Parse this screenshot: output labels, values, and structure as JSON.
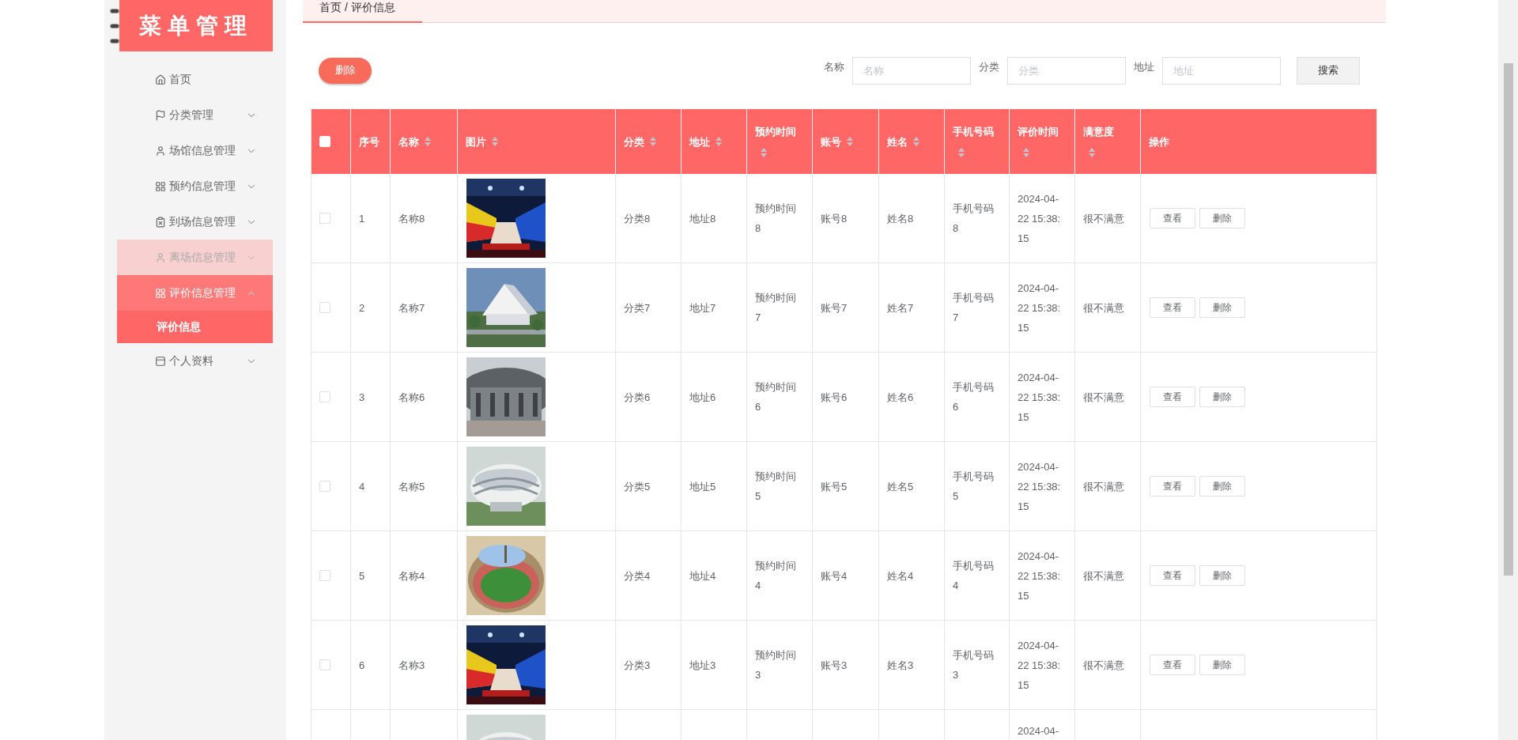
{
  "sidebar": {
    "logo": "菜单管理",
    "items": [
      {
        "label": "首页",
        "expandable": false,
        "expanded": false,
        "highlighted": false,
        "selected": false
      },
      {
        "label": "分类管理",
        "expandable": true,
        "expanded": false,
        "highlighted": false,
        "selected": false
      },
      {
        "label": "场馆信息管理",
        "expandable": true,
        "expanded": false,
        "highlighted": false,
        "selected": false
      },
      {
        "label": "预约信息管理",
        "expandable": true,
        "expanded": false,
        "highlighted": false,
        "selected": false
      },
      {
        "label": "到场信息管理",
        "expandable": true,
        "expanded": false,
        "highlighted": false,
        "selected": false
      },
      {
        "label": "离场信息管理",
        "expandable": true,
        "expanded": false,
        "highlighted": true,
        "selected": false
      },
      {
        "label": "评价信息管理",
        "expandable": true,
        "expanded": true,
        "highlighted": false,
        "selected": false,
        "children": [
          {
            "label": "评价信息",
            "selected": true
          }
        ]
      },
      {
        "label": "个人资料",
        "expandable": true,
        "expanded": false,
        "highlighted": false,
        "selected": false
      }
    ]
  },
  "breadcrumb": "首页 / 评价信息",
  "toolbar": {
    "delete_button": "删除",
    "search_fields": [
      {
        "label": "名称",
        "placeholder": "名称"
      },
      {
        "label": "分类",
        "placeholder": "分类"
      },
      {
        "label": "地址",
        "placeholder": "地址"
      }
    ],
    "search_button": "搜索"
  },
  "table": {
    "header_checkbox": {
      "checked": false
    },
    "columns": [
      {
        "label": "序号",
        "sortable": false
      },
      {
        "label": "名称",
        "sortable": true
      },
      {
        "label": "图片",
        "sortable": true
      },
      {
        "label": "分类",
        "sortable": true
      },
      {
        "label": "地址",
        "sortable": true
      },
      {
        "label": "预约时间",
        "sortable": true
      },
      {
        "label": "账号",
        "sortable": true
      },
      {
        "label": "姓名",
        "sortable": true
      },
      {
        "label": "手机号码",
        "sortable": true
      },
      {
        "label": "评价时间",
        "sortable": true
      },
      {
        "label": "满意度",
        "sortable": true
      },
      {
        "label": "操作",
        "sortable": false
      }
    ],
    "rows": [
      {
        "checked": false,
        "index": "1",
        "name": "名称8",
        "picture": {
          "kind": "picture"
        },
        "category": "分类8",
        "address": "地址8",
        "booking_time": "预约时间8",
        "account": "账号8",
        "person_name": "姓名8",
        "phone": "手机号码8",
        "evaluation_time": "2024-04-22 15:38:15",
        "satisfaction": "很不满意",
        "actions": [
          "查看",
          "删除"
        ]
      },
      {
        "checked": false,
        "index": "2",
        "name": "名称7",
        "picture": {
          "kind": "picture"
        },
        "category": "分类7",
        "address": "地址7",
        "booking_time": "预约时间7",
        "account": "账号7",
        "person_name": "姓名7",
        "phone": "手机号码7",
        "evaluation_time": "2024-04-22 15:38:15",
        "satisfaction": "很不满意",
        "actions": [
          "查看",
          "删除"
        ]
      },
      {
        "checked": false,
        "index": "3",
        "name": "名称6",
        "picture": {
          "kind": "picture"
        },
        "category": "分类6",
        "address": "地址6",
        "booking_time": "预约时间6",
        "account": "账号6",
        "person_name": "姓名6",
        "phone": "手机号码6",
        "evaluation_time": "2024-04-22 15:38:15",
        "satisfaction": "很不满意",
        "actions": [
          "查看",
          "删除"
        ]
      },
      {
        "checked": false,
        "index": "4",
        "name": "名称5",
        "picture": {
          "kind": "picture"
        },
        "category": "分类5",
        "address": "地址5",
        "booking_time": "预约时间5",
        "account": "账号5",
        "person_name": "姓名5",
        "phone": "手机号码5",
        "evaluation_time": "2024-04-22 15:38:15",
        "satisfaction": "很不满意",
        "actions": [
          "查看",
          "删除"
        ]
      },
      {
        "checked": false,
        "index": "5",
        "name": "名称4",
        "picture": {
          "kind": "picture"
        },
        "category": "分类4",
        "address": "地址4",
        "booking_time": "预约时间4",
        "account": "账号4",
        "person_name": "姓名4",
        "phone": "手机号码4",
        "evaluation_time": "2024-04-22 15:38:15",
        "satisfaction": "很不满意",
        "actions": [
          "查看",
          "删除"
        ]
      },
      {
        "checked": false,
        "index": "6",
        "name": "名称3",
        "picture": {
          "kind": "picture"
        },
        "category": "分类3",
        "address": "地址3",
        "booking_time": "预约时间3",
        "account": "账号3",
        "person_name": "姓名3",
        "phone": "手机号码3",
        "evaluation_time": "2024-04-22 15:38:15",
        "satisfaction": "很不满意",
        "actions": [
          "查看",
          "删除"
        ]
      }
    ],
    "partial_row": {
      "picture": {
        "kind": "picture"
      },
      "evaluation_time": "2024-04-"
    }
  }
}
